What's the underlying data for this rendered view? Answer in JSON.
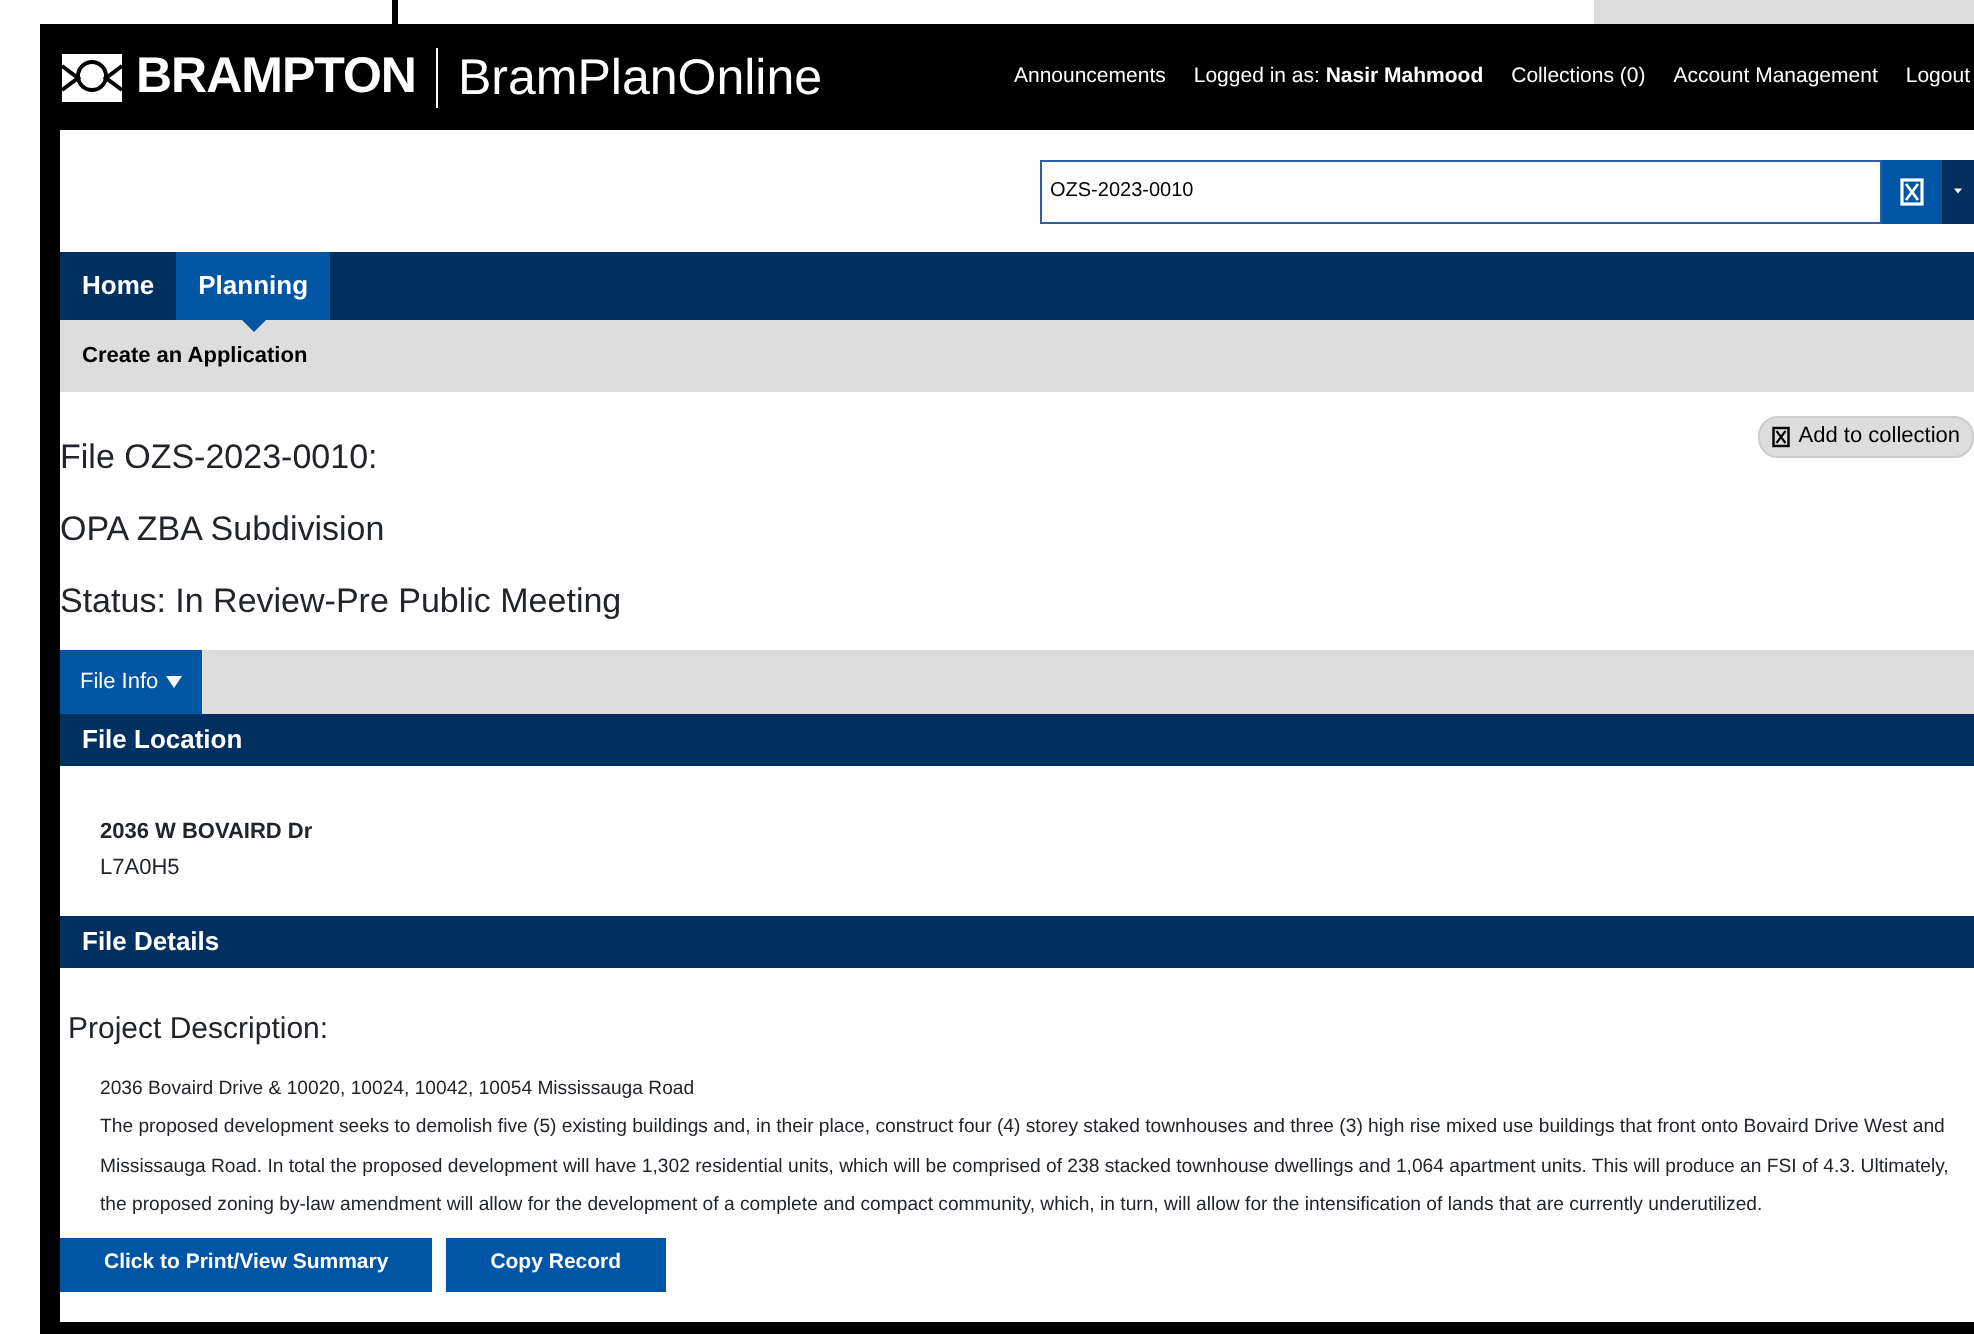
{
  "header": {
    "logo": "BRAMPTON",
    "app_name": "BramPlanOnline",
    "links": [
      {
        "kind": "link",
        "label": "Announcements"
      },
      {
        "kind": "user",
        "label": "Logged in as:",
        "value": "Nasir Mahmood"
      },
      {
        "kind": "link",
        "label": "Collections (0)"
      },
      {
        "kind": "link",
        "label": "Account Management"
      },
      {
        "kind": "link",
        "label": "Logout"
      }
    ]
  },
  "search": {
    "value": "OZS-2023-0010"
  },
  "tabs": [
    {
      "label": "Home",
      "selected": false
    },
    {
      "label": "Planning",
      "selected": true
    }
  ],
  "subnav": [
    "Create an Application"
  ],
  "add_to_collection": "Add to collection",
  "titles": [
    "File OZS-2023-0010:",
    "OPA ZBA Subdivision",
    "Status: In Review-Pre Public Meeting"
  ],
  "section_tabs": [
    {
      "label": "File Info",
      "selected": true
    }
  ],
  "file_location": {
    "heading": "File Location",
    "address": "2036 W BOVAIRD Dr",
    "postal_code": "L7A0H5"
  },
  "file_details": {
    "heading": "File Details",
    "subheading": "Project Description:",
    "lines": [
      "2036 Bovaird Drive & 10020, 10024, 10042, 10054 Mississauga Road",
      "The proposed development seeks to demolish five (5) existing buildings and, in their place, construct four (4) storey staked townhouses and three (3) high rise mixed use buildings that front onto Bovaird Drive West and Mississauga Road. In total the proposed development will have 1,302 residential units, which will be comprised of 238 stacked townhouse dwellings and 1,064 apartment units. This will produce an FSI of 4.3. Ultimately, the proposed zoning by-law amendment will allow for the development of a complete and compact community, which, in turn, will allow for the intensification of lands that are currently underutilized."
    ]
  },
  "buttons": [
    "Click to Print/View Summary",
    "Copy Record"
  ]
}
